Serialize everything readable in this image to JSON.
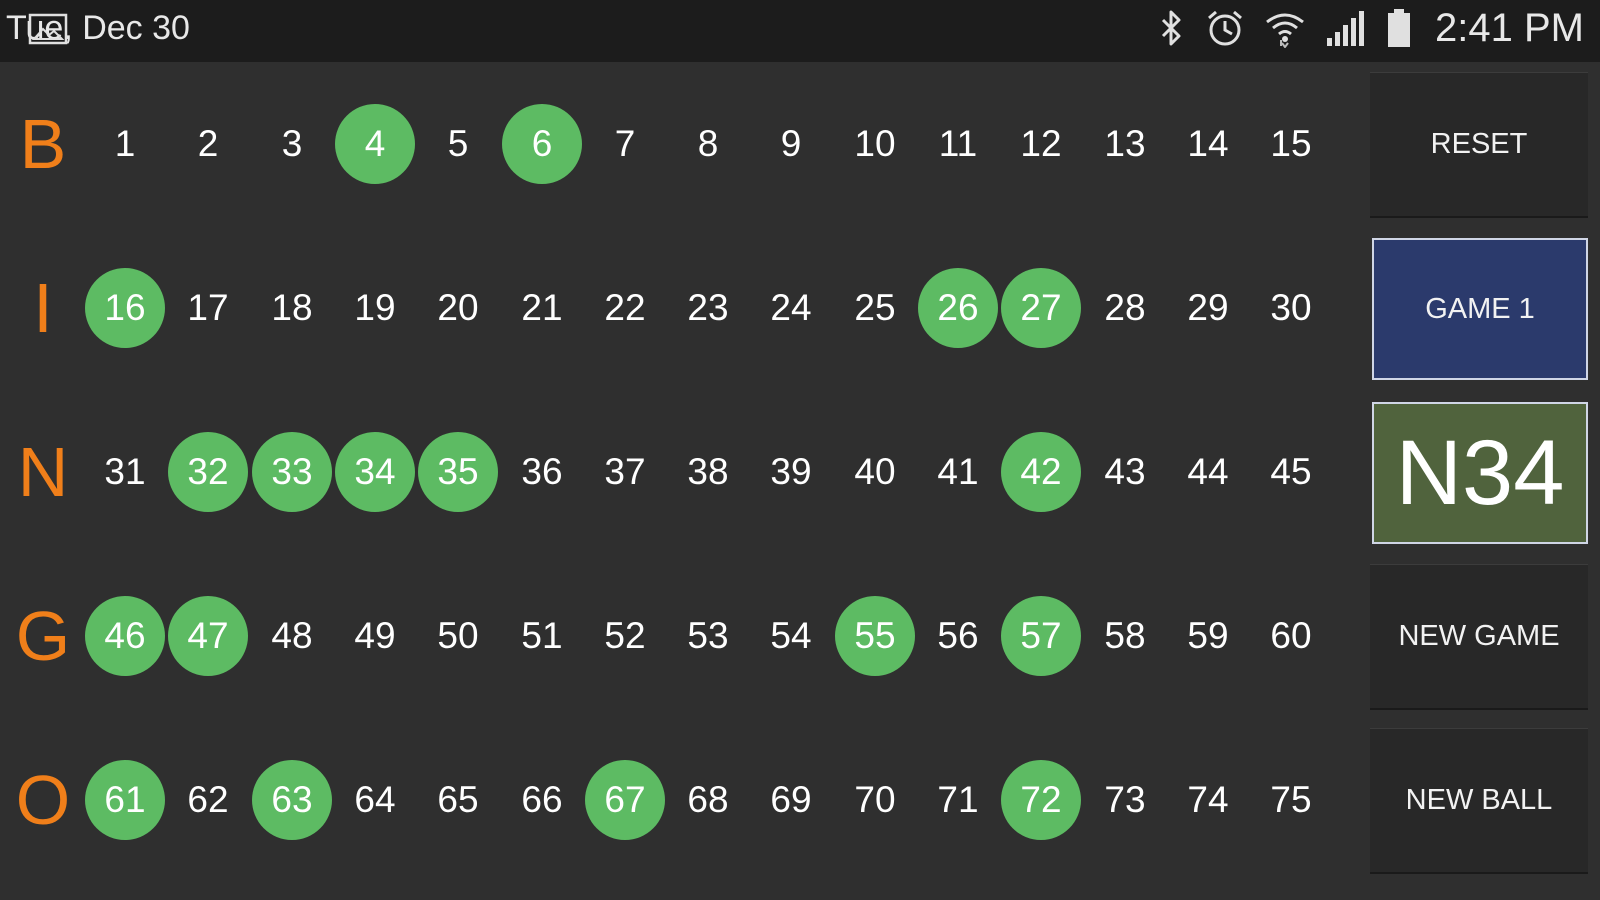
{
  "status_bar": {
    "date": "Tue, Dec 30",
    "time": "2:41 PM",
    "icons": [
      "gallery-icon",
      "bluetooth-icon",
      "alarm-icon",
      "wifi-icon",
      "signal-icon",
      "battery-icon"
    ]
  },
  "board": {
    "rows": [
      {
        "letter": "B",
        "numbers": [
          1,
          2,
          3,
          4,
          5,
          6,
          7,
          8,
          9,
          10,
          11,
          12,
          13,
          14,
          15
        ]
      },
      {
        "letter": "I",
        "numbers": [
          16,
          17,
          18,
          19,
          20,
          21,
          22,
          23,
          24,
          25,
          26,
          27,
          28,
          29,
          30
        ]
      },
      {
        "letter": "N",
        "numbers": [
          31,
          32,
          33,
          34,
          35,
          36,
          37,
          38,
          39,
          40,
          41,
          42,
          43,
          44,
          45
        ]
      },
      {
        "letter": "G",
        "numbers": [
          46,
          47,
          48,
          49,
          50,
          51,
          52,
          53,
          54,
          55,
          56,
          57,
          58,
          59,
          60
        ]
      },
      {
        "letter": "O",
        "numbers": [
          61,
          62,
          63,
          64,
          65,
          66,
          67,
          68,
          69,
          70,
          71,
          72,
          73,
          74,
          75
        ]
      }
    ],
    "called": [
      4,
      6,
      16,
      26,
      27,
      32,
      33,
      34,
      35,
      42,
      46,
      47,
      55,
      57,
      61,
      63,
      67,
      72
    ]
  },
  "controls": {
    "reset_label": "RESET",
    "game_label": "GAME 1",
    "current_ball": "N34",
    "new_game_label": "NEW GAME",
    "new_ball_label": "NEW BALL"
  },
  "colors": {
    "background": "#2f2f2f",
    "letter": "#f07f1a",
    "called": "#5dbb63",
    "game_button": "#2b3a6c",
    "current_ball": "#50633d"
  }
}
